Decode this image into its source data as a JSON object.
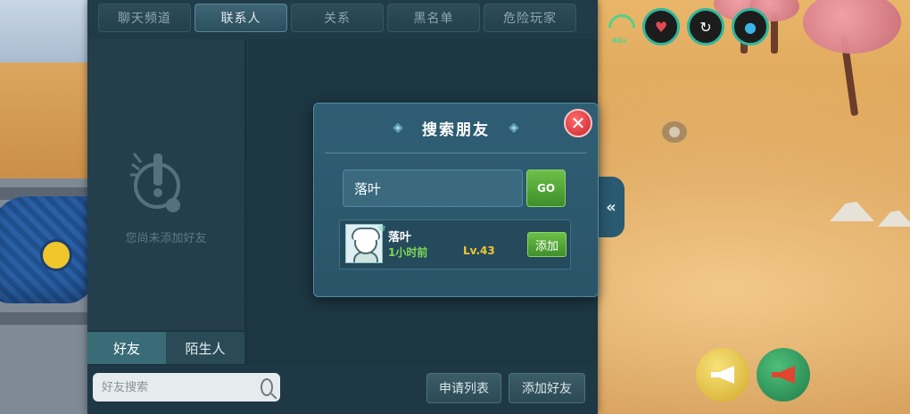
{
  "hud": {
    "signal_text": "4Gs",
    "heart_icon": "heart-icon",
    "stamina_icon": "stamina-icon",
    "water_icon": "water-drop-icon"
  },
  "tabs": [
    {
      "label": "聊天频道",
      "active": false
    },
    {
      "label": "联系人",
      "active": true
    },
    {
      "label": "关系",
      "active": false
    },
    {
      "label": "黑名单",
      "active": false
    },
    {
      "label": "危险玩家",
      "active": false
    }
  ],
  "contacts": {
    "empty_text": "您尚未添加好友",
    "sub_tabs": [
      {
        "label": "好友",
        "active": true
      },
      {
        "label": "陌生人",
        "active": false
      }
    ]
  },
  "bottom_bar": {
    "search_placeholder": "好友搜索",
    "request_list_label": "申请列表",
    "add_friend_label": "添加好友"
  },
  "dialog": {
    "title": "搜索朋友",
    "close_glyph": "✕",
    "input_value": "落叶",
    "go_label": "GO",
    "result": {
      "name": "落叶",
      "last_online": "1小时前",
      "level": "Lv.43",
      "add_label": "添加",
      "badge": "❀"
    }
  },
  "side": {
    "collapse_glyph": "«"
  },
  "colors": {
    "panel_bg": "#1f3c48",
    "dialog_bg": "#2f5e74",
    "accent_green": "#6cbf47",
    "level_gold": "#f2c433",
    "time_green": "#7ed957",
    "close_red": "#c9252b"
  }
}
